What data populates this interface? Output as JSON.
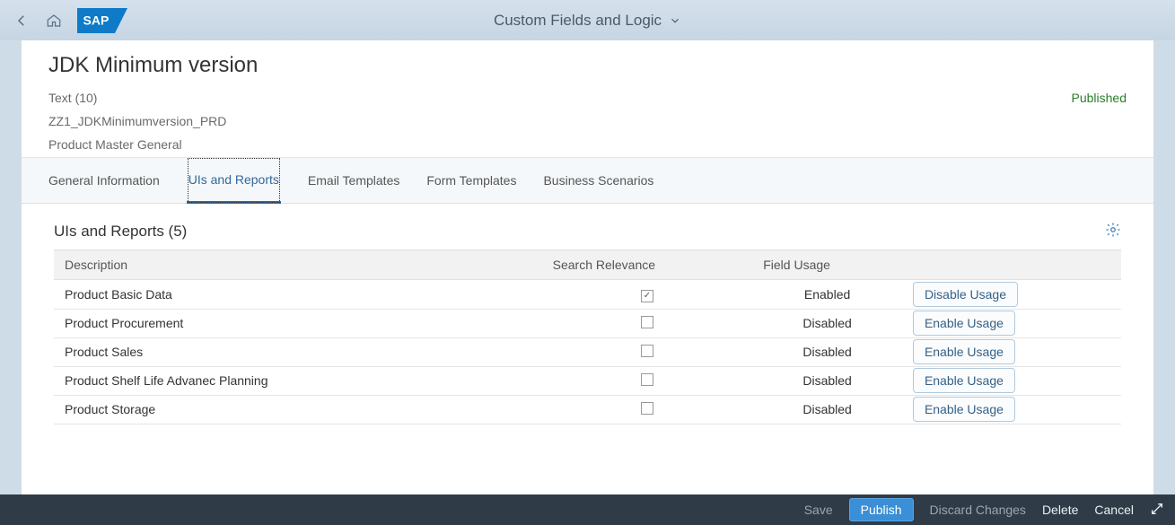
{
  "shell": {
    "title": "Custom Fields and Logic"
  },
  "header": {
    "title": "JDK Minimum version",
    "type_line": "Text (10)",
    "technical_name": "ZZ1_JDKMinimumversion_PRD",
    "context": "Product Master General",
    "status": "Published"
  },
  "tabs": {
    "items": [
      {
        "label": "General Information"
      },
      {
        "label": "UIs and Reports"
      },
      {
        "label": "Email Templates"
      },
      {
        "label": "Form Templates"
      },
      {
        "label": "Business Scenarios"
      }
    ]
  },
  "section": {
    "title": "UIs and Reports (5)",
    "columns": {
      "description": "Description",
      "search_relevance": "Search Relevance",
      "field_usage": "Field Usage"
    },
    "rows": [
      {
        "description": "Product Basic Data",
        "search": true,
        "usage": "Enabled",
        "action": "Disable Usage"
      },
      {
        "description": "Product Procurement",
        "search": false,
        "usage": "Disabled",
        "action": "Enable Usage"
      },
      {
        "description": "Product Sales",
        "search": false,
        "usage": "Disabled",
        "action": "Enable Usage"
      },
      {
        "description": "Product Shelf Life Advanec Planning",
        "search": false,
        "usage": "Disabled",
        "action": "Enable Usage"
      },
      {
        "description": "Product Storage",
        "search": false,
        "usage": "Disabled",
        "action": "Enable Usage"
      }
    ]
  },
  "footer": {
    "save": "Save",
    "publish": "Publish",
    "discard": "Discard Changes",
    "delete": "Delete",
    "cancel": "Cancel"
  }
}
